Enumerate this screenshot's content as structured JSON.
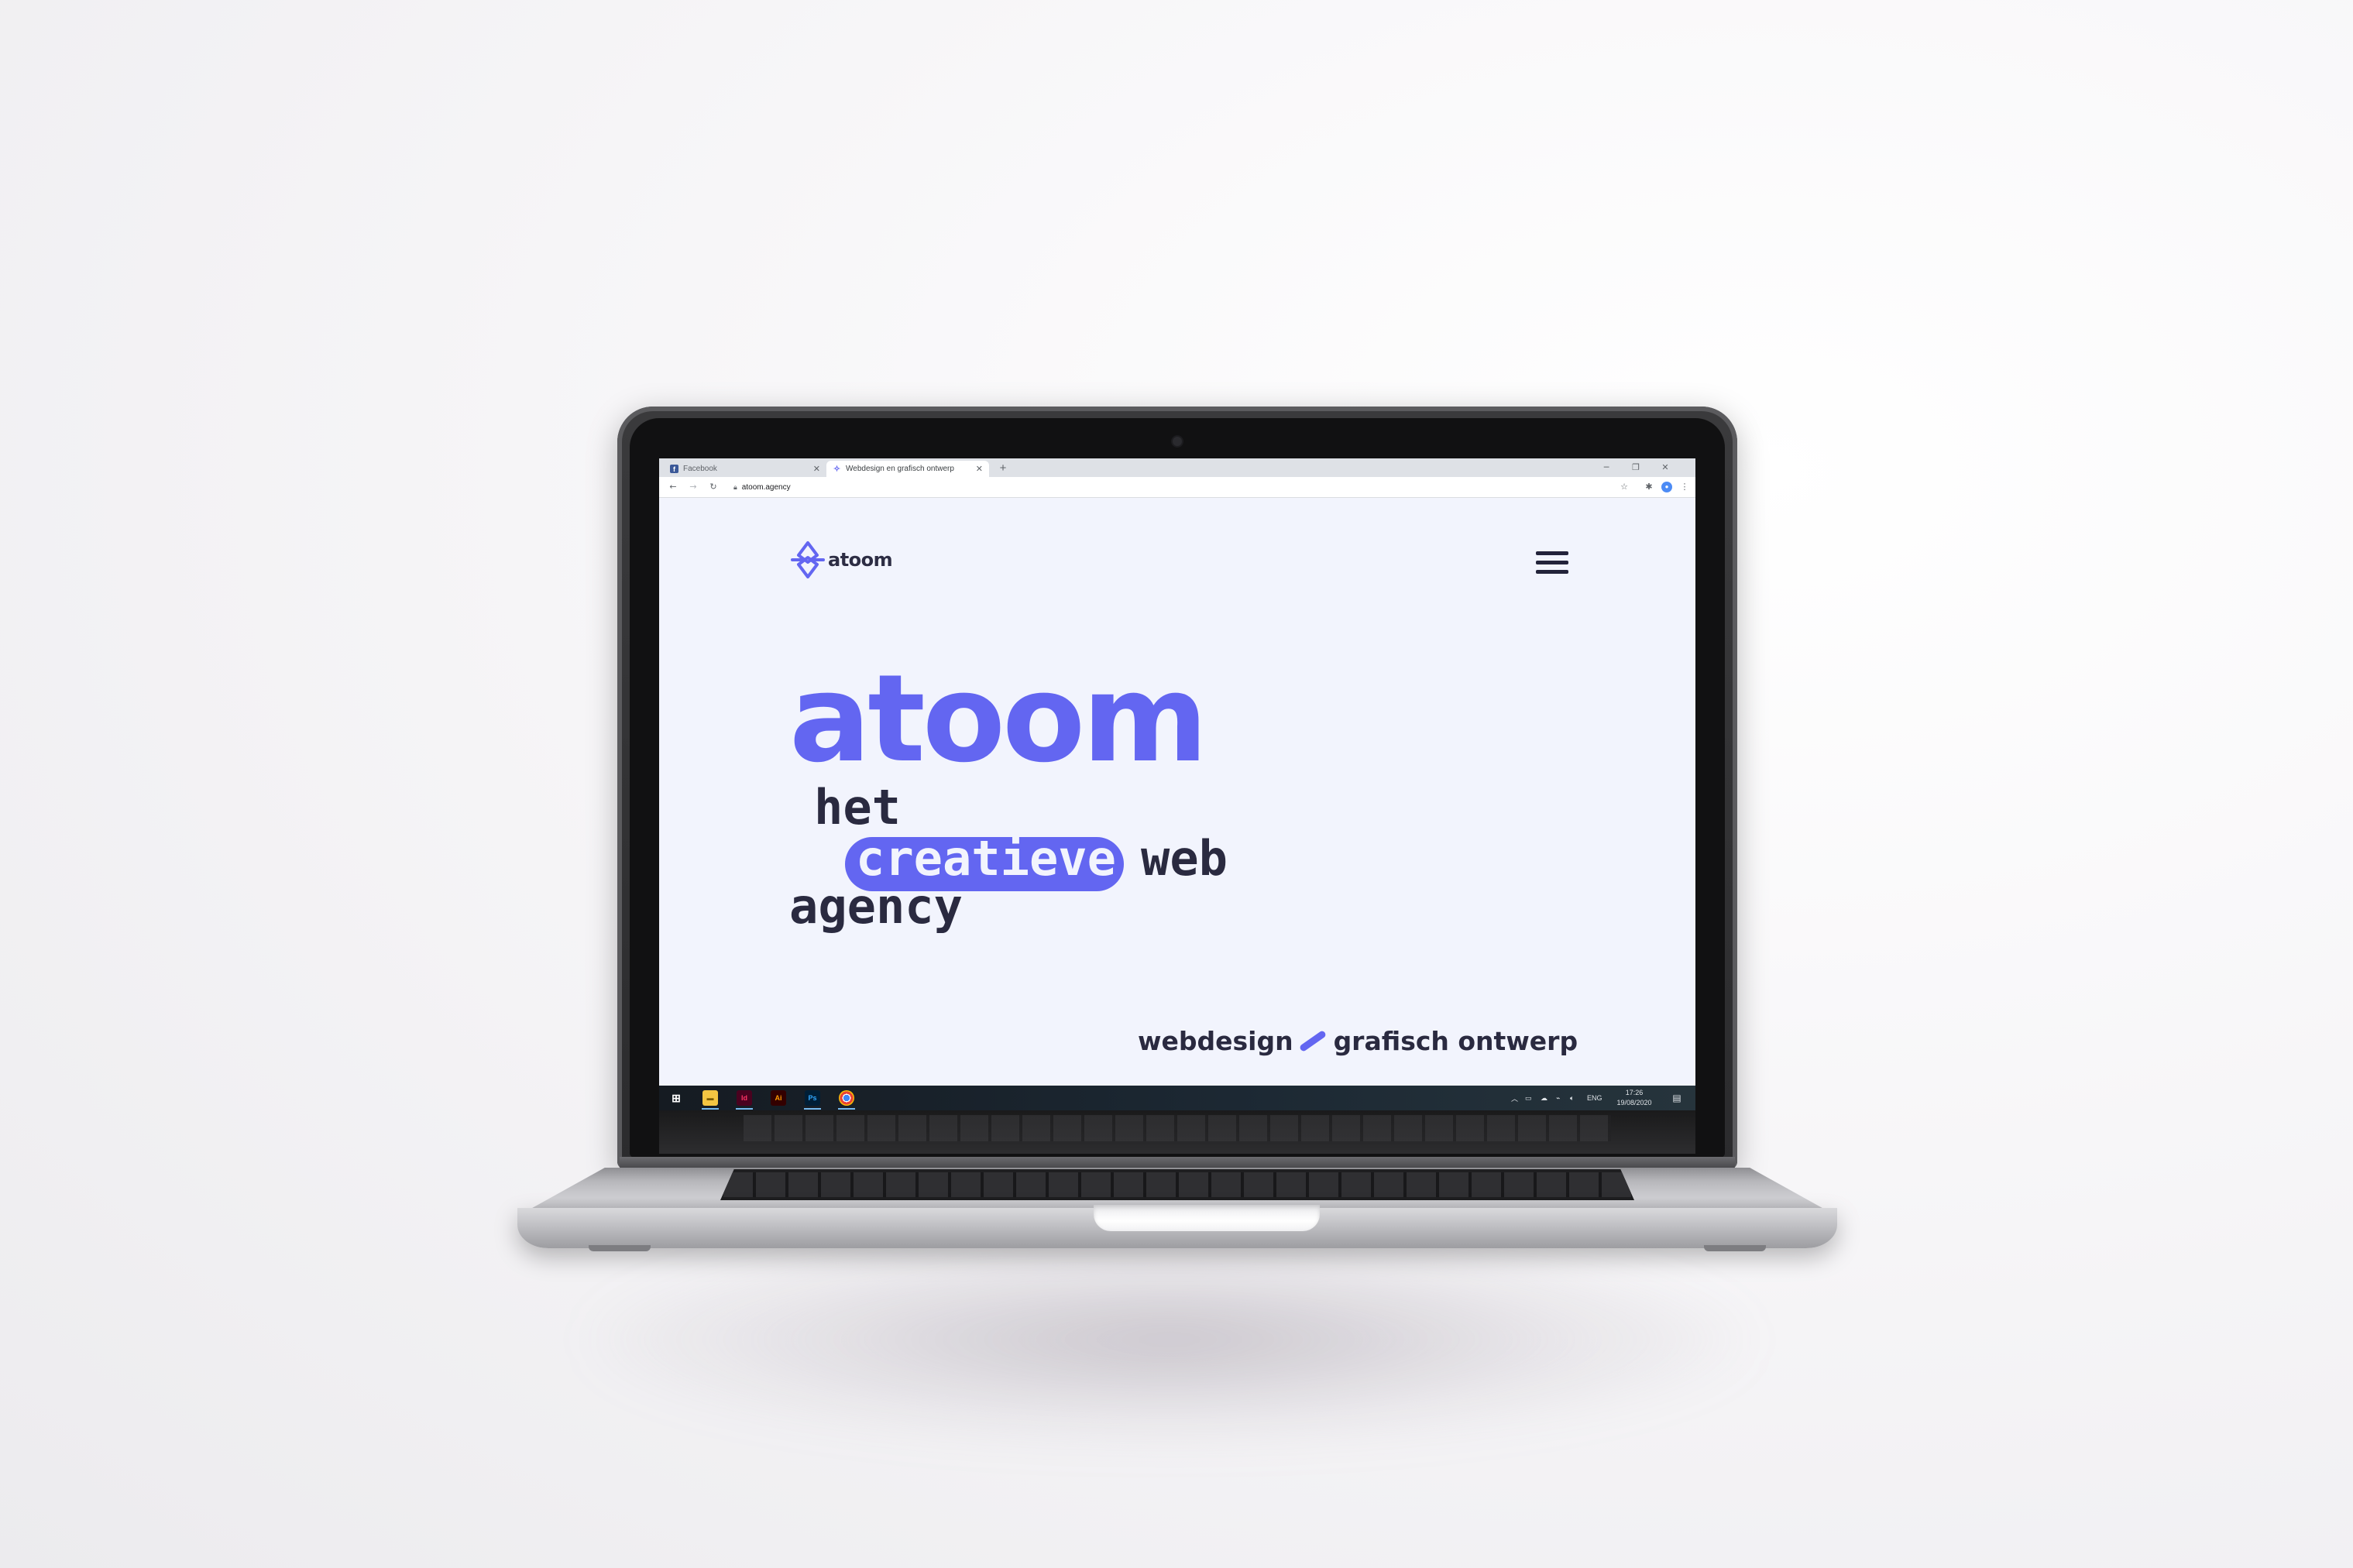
{
  "browser": {
    "tabs": [
      {
        "label": "Facebook",
        "active": false
      },
      {
        "label": "Webdesign en grafisch ontwerp",
        "active": true
      }
    ],
    "url": "atoom.agency"
  },
  "site": {
    "logo_text": "atoom",
    "hero_title": "atoom",
    "subtitle": {
      "line1": "het",
      "highlight": "creatieve",
      "line2_rest": "web",
      "line3": "agency"
    },
    "tagline": {
      "left": "webdesign",
      "right": "grafisch ontwerp"
    }
  },
  "taskbar": {
    "apps": [
      "file-explorer",
      "indesign",
      "illustrator",
      "photoshop",
      "chrome"
    ],
    "app_labels": {
      "indesign": "Id",
      "illustrator": "Ai",
      "photoshop": "Ps"
    },
    "language": "ENG",
    "time": "17:26",
    "date": "19/08/2020"
  },
  "colors": {
    "accent": "#6366f1",
    "ink": "#2a2a40",
    "page_bg": "#f2f4fd"
  }
}
